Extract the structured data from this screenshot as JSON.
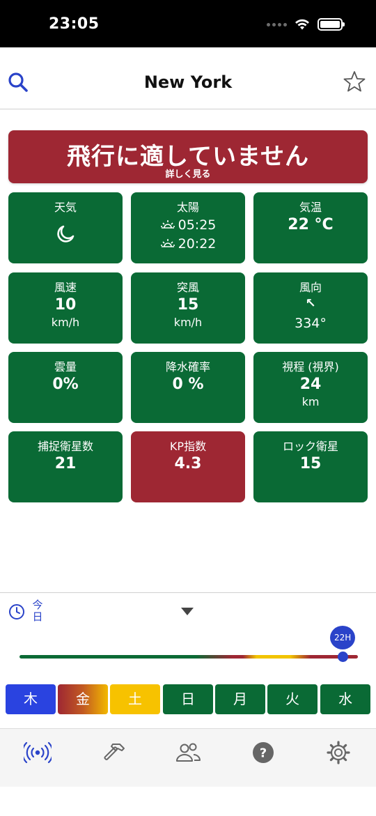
{
  "status_bar": {
    "time": "23:05"
  },
  "header": {
    "title": "New York"
  },
  "banner": {
    "title": "飛行に適していません",
    "subtitle": "詳しく見る",
    "color": "#9e2733"
  },
  "tiles": {
    "weather": {
      "label": "天気",
      "icon": "moon-icon"
    },
    "sun": {
      "label": "太陽",
      "sunrise": "05:25",
      "sunset": "20:22"
    },
    "temperature": {
      "label": "気温",
      "value": "22 °C"
    },
    "wind_speed": {
      "label": "風速",
      "value": "10",
      "unit": "km/h"
    },
    "gust": {
      "label": "突風",
      "value": "15",
      "unit": "km/h"
    },
    "wind_direction": {
      "label": "風向",
      "arrow": "↖",
      "value": "334°"
    },
    "cloud_cover": {
      "label": "雲量",
      "value": "0%"
    },
    "precipitation": {
      "label": "降水確率",
      "value": "0 %"
    },
    "visibility": {
      "label": "視程 (視界)",
      "value": "24",
      "unit": "km"
    },
    "satellites": {
      "label": "捕捉衛星数",
      "value": "21"
    },
    "kp_index": {
      "label": "KP指数",
      "value": "4.3"
    },
    "locked_satellites": {
      "label": "ロック衛星",
      "value": "15"
    }
  },
  "time_selector": {
    "today_label": "今日",
    "hour_label": "22H",
    "slider_position": 0.955
  },
  "days": [
    {
      "label": "木",
      "status": "selected"
    },
    {
      "label": "金",
      "status": "mixed"
    },
    {
      "label": "土",
      "status": "caution"
    },
    {
      "label": "日",
      "status": "good"
    },
    {
      "label": "月",
      "status": "good"
    },
    {
      "label": "火",
      "status": "good"
    },
    {
      "label": "水",
      "status": "good"
    }
  ],
  "tab_bar": {
    "items": [
      {
        "icon": "broadcast-icon",
        "active": true
      },
      {
        "icon": "hammer-icon",
        "active": false
      },
      {
        "icon": "people-icon",
        "active": false
      },
      {
        "icon": "help-icon",
        "active": false
      },
      {
        "icon": "settings-icon",
        "active": false
      }
    ]
  },
  "colors": {
    "good": "#0a6a35",
    "bad": "#9e2733",
    "caution": "#f7c200",
    "accent": "#2a43e0"
  }
}
